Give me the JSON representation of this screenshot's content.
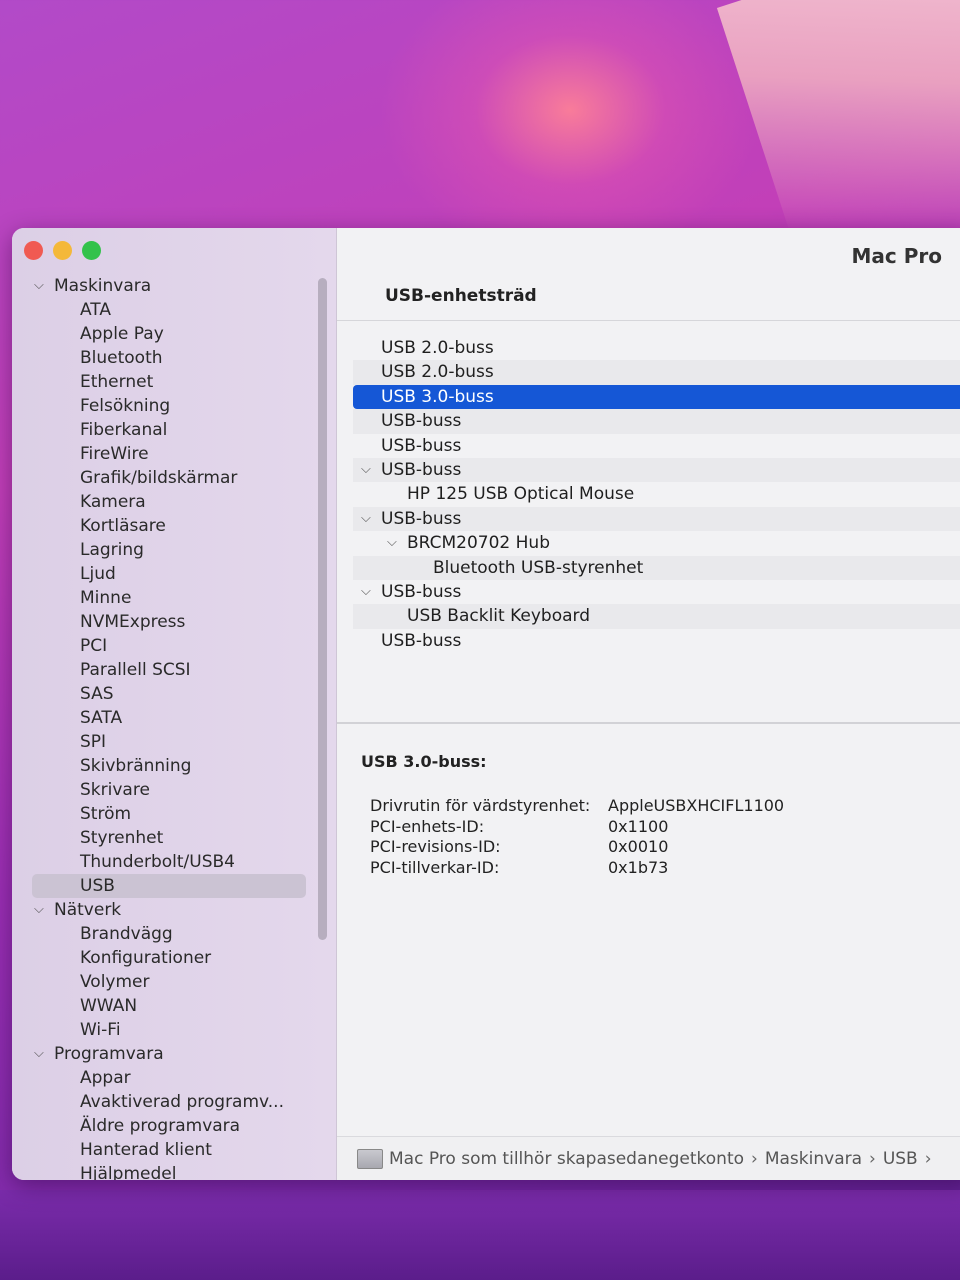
{
  "window": {
    "model_title": "Mac Pro"
  },
  "sidebar": {
    "groups": [
      {
        "label": "Maskinvara",
        "items": [
          "ATA",
          "Apple Pay",
          "Bluetooth",
          "Ethernet",
          "Felsökning",
          "Fiberkanal",
          "FireWire",
          "Grafik/bildskärmar",
          "Kamera",
          "Kortläsare",
          "Lagring",
          "Ljud",
          "Minne",
          "NVMExpress",
          "PCI",
          "Parallell SCSI",
          "SAS",
          "SATA",
          "SPI",
          "Skivbränning",
          "Skrivare",
          "Ström",
          "Styrenhet",
          "Thunderbolt/USB4",
          "USB"
        ]
      },
      {
        "label": "Nätverk",
        "items": [
          "Brandvägg",
          "Konfigurationer",
          "Volymer",
          "WWAN",
          "Wi-Fi"
        ]
      },
      {
        "label": "Programvara",
        "items": [
          "Appar",
          "Avaktiverad programv...",
          "Äldre programvara",
          "Hanterad klient",
          "Hjälpmedel"
        ]
      }
    ],
    "selected": "USB"
  },
  "usb_tree": {
    "header": "USB-enhetsträd",
    "rows": [
      {
        "label": "USB 2.0-buss"
      },
      {
        "label": "USB 2.0-buss"
      },
      {
        "label": "USB 3.0-buss",
        "selected": true
      },
      {
        "label": "USB-buss"
      },
      {
        "label": "USB-buss"
      },
      {
        "label": "USB-buss",
        "expanded": true
      },
      {
        "label": "HP 125 USB Optical Mouse"
      },
      {
        "label": "USB-buss",
        "expanded": true
      },
      {
        "label": "BRCM20702 Hub",
        "expanded": true
      },
      {
        "label": "Bluetooth USB-styrenhet"
      },
      {
        "label": "USB-buss",
        "expanded": true
      },
      {
        "label": "USB Backlit Keyboard"
      },
      {
        "label": "USB-buss"
      }
    ]
  },
  "details": {
    "title": "USB 3.0-buss:",
    "properties": [
      {
        "key": "Drivrutin för värdstyrenhet:",
        "value": "AppleUSBXHCIFL1100"
      },
      {
        "key": "PCI-enhets-ID:",
        "value": "0x1100"
      },
      {
        "key": "PCI-revisions-ID:",
        "value": "0x0010"
      },
      {
        "key": "PCI-tillverkar-ID:",
        "value": "0x1b73"
      }
    ]
  },
  "footer": {
    "crumbs": [
      "Mac Pro som tillhör skapasedanegetkonto",
      "Maskinvara",
      "USB"
    ]
  }
}
